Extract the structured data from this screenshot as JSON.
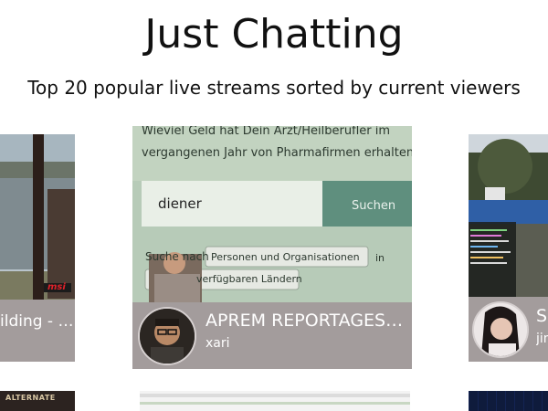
{
  "page": {
    "title": "Just Chatting",
    "subtitle": "Top 20 popular live streams sorted by current viewers"
  },
  "streams": [
    {
      "title": "ilding - …",
      "user": "",
      "thumb_text": "msi"
    },
    {
      "title": "APREM REPORTAGES…",
      "user": "xari",
      "thumb_text": {
        "line1": "Wieviel Geld hat Dein Arzt/Heilberufler im",
        "line2": "vergangenen Jahr von Pharmafirmen erhalten?",
        "search_value": "diener",
        "search_button": "Suchen",
        "search_label": "Suche nach",
        "select1": "Personen und Organisationen",
        "select1_suffix": "in",
        "select2": "verfügbaren Ländern"
      }
    },
    {
      "title": "S",
      "user": "jin"
    }
  ],
  "second_row": {
    "left_text": "ALTERNATE"
  },
  "colors": {
    "card_bg": "#a39c9c",
    "title_text": "#111111"
  }
}
